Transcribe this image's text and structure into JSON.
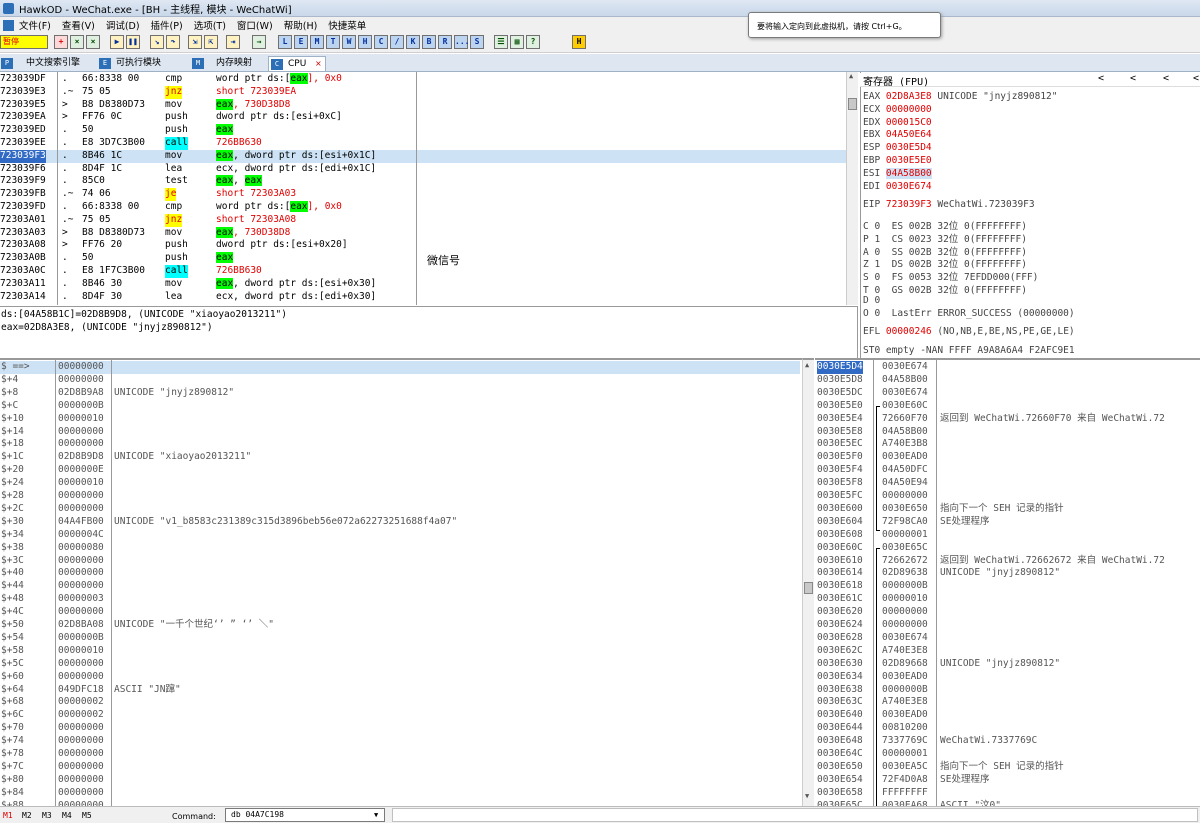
{
  "window": {
    "title": "HawkOD - WeChat.exe - [BH - 主线程, 模块 - WeChatWi]"
  },
  "tooltip": {
    "text": "要将输入定向到此虚拟机，请按 Ctrl+G。"
  },
  "menu": [
    "文件(F)",
    "查看(V)",
    "调试(D)",
    "插件(P)",
    "选项(T)",
    "窗口(W)",
    "帮助(H)",
    "快捷菜单"
  ],
  "toolbar": {
    "status_label": "暂停",
    "letter_buttons": [
      "L",
      "E",
      "M",
      "T",
      "W",
      "H",
      "C",
      "/",
      "K",
      "B",
      "R",
      "...",
      "S"
    ],
    "h_button": "H"
  },
  "tabs": [
    {
      "icon": "P",
      "label": ""
    },
    {
      "icon": "",
      "label": "中文搜索引擎"
    },
    {
      "icon": "E",
      "label": "可执行模块"
    },
    {
      "icon": "M",
      "label": "内存映射"
    },
    {
      "icon": "C",
      "label": "CPU"
    }
  ],
  "disasm": [
    {
      "addr": "723039DF",
      "mark": ".",
      "hex": "66:8338 00",
      "op": "cmp",
      "args": [
        "word ptr ds:[",
        "eax",
        "], 0x0"
      ]
    },
    {
      "addr": "723039E3",
      "mark": ".~",
      "hex": "75 05",
      "op": "jnz",
      "args": [
        "short 723039EA"
      ]
    },
    {
      "addr": "723039E5",
      "mark": ">",
      "hex": "B8 D8380D73",
      "op": "mov",
      "args": [
        "eax",
        ", 730D38D8"
      ]
    },
    {
      "addr": "723039EA",
      "mark": ">",
      "hex": "FF76 0C",
      "op": "push",
      "args": [
        "dword ptr ds:[esi+0xC]"
      ]
    },
    {
      "addr": "723039ED",
      "mark": ".",
      "hex": "50",
      "op": "push",
      "args": [
        "eax"
      ]
    },
    {
      "addr": "723039EE",
      "mark": ".",
      "hex": "E8 3D7C3B00",
      "op": "call",
      "args": [
        "726BB630"
      ]
    },
    {
      "addr": "723039F3",
      "mark": ".",
      "hex": "8B46 1C",
      "op": "mov",
      "args": [
        "eax",
        ", dword ptr ds:[esi+0x1C]"
      ]
    },
    {
      "addr": "723039F6",
      "mark": ".",
      "hex": "8D4F 1C",
      "op": "lea",
      "args": [
        "ecx, dword ptr ds:[edi+0x1C]"
      ]
    },
    {
      "addr": "723039F9",
      "mark": ".",
      "hex": "85C0",
      "op": "test",
      "args": [
        "eax",
        ", ",
        "eax"
      ]
    },
    {
      "addr": "723039FB",
      "mark": ".~",
      "hex": "74 06",
      "op": "je",
      "args": [
        "short 72303A03"
      ]
    },
    {
      "addr": "723039FD",
      "mark": ".",
      "hex": "66:8338 00",
      "op": "cmp",
      "args": [
        "word ptr ds:[",
        "eax",
        "], 0x0"
      ]
    },
    {
      "addr": "72303A01",
      "mark": ".~",
      "hex": "75 05",
      "op": "jnz",
      "args": [
        "short 72303A08"
      ]
    },
    {
      "addr": "72303A03",
      "mark": ">",
      "hex": "B8 D8380D73",
      "op": "mov",
      "args": [
        "eax",
        ", 730D38D8"
      ]
    },
    {
      "addr": "72303A08",
      "mark": ">",
      "hex": "FF76 20",
      "op": "push",
      "args": [
        "dword ptr ds:[esi+0x20]"
      ]
    },
    {
      "addr": "72303A0B",
      "mark": ".",
      "hex": "50",
      "op": "push",
      "args": [
        "eax"
      ]
    },
    {
      "addr": "72303A0C",
      "mark": ".",
      "hex": "E8 1F7C3B00",
      "op": "call",
      "args": [
        "726BB630"
      ]
    },
    {
      "addr": "72303A11",
      "mark": ".",
      "hex": "8B46 30",
      "op": "mov",
      "args": [
        "eax",
        ", dword ptr ds:[esi+0x30]"
      ]
    },
    {
      "addr": "72303A14",
      "mark": ".",
      "hex": "8D4F 30",
      "op": "lea",
      "args": [
        "ecx, dword ptr ds:[edi+0x30]"
      ]
    }
  ],
  "disasm_comment": "微信号",
  "info": [
    "ds:[04A58B1C]=02D8B9D8, (UNICODE \"xiaoyao2013211\")",
    "eax=02D8A3E8, (UNICODE \"jnyjz890812\")"
  ],
  "registers": {
    "header": "寄存器 (FPU)",
    "nav": [
      "<",
      "<",
      "<",
      "<"
    ],
    "lines": [
      {
        "name": "EAX",
        "val": "02D8A3E8",
        "note": "UNICODE \"jnyjz890812\""
      },
      {
        "name": "ECX",
        "val": "00000000",
        "note": ""
      },
      {
        "name": "EDX",
        "val": "000015C0",
        "note": ""
      },
      {
        "name": "EBX",
        "val": "04A50E64",
        "note": ""
      },
      {
        "name": "ESP",
        "val": "0030E5D4",
        "note": ""
      },
      {
        "name": "EBP",
        "val": "0030E5E0",
        "note": ""
      },
      {
        "name": "ESI",
        "val": "04A58B00",
        "note": ""
      },
      {
        "name": "EDI",
        "val": "0030E674",
        "note": ""
      }
    ],
    "eip": {
      "name": "EIP",
      "val": "723039F3",
      "note": "WeChatWi.723039F3"
    },
    "flags": [
      "C 0  ES 002B 32位 0(FFFFFFFF)",
      "P 1  CS 0023 32位 0(FFFFFFFF)",
      "A 0  SS 002B 32位 0(FFFFFFFF)",
      "Z 1  DS 002B 32位 0(FFFFFFFF)",
      "S 0  FS 0053 32位 7EFDD000(FFF)",
      "T 0  GS 002B 32位 0(FFFFFFFF)",
      "D 0",
      "O 0  LastErr ERROR_SUCCESS (00000000)"
    ],
    "efl": {
      "name": "EFL",
      "val": "00000246",
      "note": "(NO,NB,E,BE,NS,PE,GE,LE)"
    },
    "st0": "ST0 empty -NAN FFFF A9A8A6A4 F2AFC9E1"
  },
  "stack": [
    {
      "off": "$ ==>",
      "val": "00000000",
      "note": ""
    },
    {
      "off": "$+4",
      "val": "00000000",
      "note": ""
    },
    {
      "off": "$+8",
      "val": "02D8B9A8",
      "note": "UNICODE \"jnyjz890812\""
    },
    {
      "off": "$+C",
      "val": "0000000B",
      "note": ""
    },
    {
      "off": "$+10",
      "val": "00000010",
      "note": ""
    },
    {
      "off": "$+14",
      "val": "00000000",
      "note": ""
    },
    {
      "off": "$+18",
      "val": "00000000",
      "note": ""
    },
    {
      "off": "$+1C",
      "val": "02D8B9D8",
      "note": "UNICODE \"xiaoyao2013211\""
    },
    {
      "off": "$+20",
      "val": "0000000E",
      "note": ""
    },
    {
      "off": "$+24",
      "val": "00000010",
      "note": ""
    },
    {
      "off": "$+28",
      "val": "00000000",
      "note": ""
    },
    {
      "off": "$+2C",
      "val": "00000000",
      "note": ""
    },
    {
      "off": "$+30",
      "val": "04A4FB00",
      "note": "UNICODE \"v1_b8583c231389c315d3896beb56e072a62273251688f4a07\""
    },
    {
      "off": "$+34",
      "val": "0000004C",
      "note": ""
    },
    {
      "off": "$+38",
      "val": "00000080",
      "note": ""
    },
    {
      "off": "$+3C",
      "val": "00000000",
      "note": ""
    },
    {
      "off": "$+40",
      "val": "00000000",
      "note": ""
    },
    {
      "off": "$+44",
      "val": "00000000",
      "note": ""
    },
    {
      "off": "$+48",
      "val": "00000003",
      "note": ""
    },
    {
      "off": "$+4C",
      "val": "00000000",
      "note": ""
    },
    {
      "off": "$+50",
      "val": "02D8BA08",
      "note": "UNICODE \"一千个世纪‘’ ” ‘’ ＼\""
    },
    {
      "off": "$+54",
      "val": "0000000B",
      "note": ""
    },
    {
      "off": "$+58",
      "val": "00000010",
      "note": ""
    },
    {
      "off": "$+5C",
      "val": "00000000",
      "note": ""
    },
    {
      "off": "$+60",
      "val": "00000000",
      "note": ""
    },
    {
      "off": "$+64",
      "val": "049DFC18",
      "note": "ASCII \"JN蹿\""
    },
    {
      "off": "$+68",
      "val": "00000002",
      "note": ""
    },
    {
      "off": "$+6C",
      "val": "00000002",
      "note": ""
    },
    {
      "off": "$+70",
      "val": "00000000",
      "note": ""
    },
    {
      "off": "$+74",
      "val": "00000000",
      "note": ""
    },
    {
      "off": "$+78",
      "val": "00000000",
      "note": ""
    },
    {
      "off": "$+7C",
      "val": "00000000",
      "note": ""
    },
    {
      "off": "$+80",
      "val": "00000000",
      "note": ""
    },
    {
      "off": "$+84",
      "val": "00000000",
      "note": ""
    },
    {
      "off": "$+88",
      "val": "00000000",
      "note": ""
    }
  ],
  "mem": [
    {
      "addr": "0030E5D4",
      "val": "0030E674",
      "note": ""
    },
    {
      "addr": "0030E5D8",
      "val": "04A58B00",
      "note": ""
    },
    {
      "addr": "0030E5DC",
      "val": "0030E674",
      "note": ""
    },
    {
      "addr": "0030E5E0",
      "val": "0030E60C",
      "note": ""
    },
    {
      "addr": "0030E5E4",
      "val": "72660F70",
      "note": "返回到 WeChatWi.72660F70 来自 WeChatWi.72"
    },
    {
      "addr": "0030E5E8",
      "val": "04A58B00",
      "note": ""
    },
    {
      "addr": "0030E5EC",
      "val": "A740E3B8",
      "note": ""
    },
    {
      "addr": "0030E5F0",
      "val": "0030EAD0",
      "note": ""
    },
    {
      "addr": "0030E5F4",
      "val": "04A50DFC",
      "note": ""
    },
    {
      "addr": "0030E5F8",
      "val": "04A50E94",
      "note": ""
    },
    {
      "addr": "0030E5FC",
      "val": "00000000",
      "note": ""
    },
    {
      "addr": "0030E600",
      "val": "0030E650",
      "note": "指向下一个 SEH 记录的指针"
    },
    {
      "addr": "0030E604",
      "val": "72F98CA0",
      "note": "SE处理程序"
    },
    {
      "addr": "0030E608",
      "val": "00000001",
      "note": ""
    },
    {
      "addr": "0030E60C",
      "val": "0030E65C",
      "note": ""
    },
    {
      "addr": "0030E610",
      "val": "72662672",
      "note": "返回到 WeChatWi.72662672 来自 WeChatWi.72"
    },
    {
      "addr": "0030E614",
      "val": "02D89638",
      "note": "UNICODE \"jnyjz890812\""
    },
    {
      "addr": "0030E618",
      "val": "0000000B",
      "note": ""
    },
    {
      "addr": "0030E61C",
      "val": "00000010",
      "note": ""
    },
    {
      "addr": "0030E620",
      "val": "00000000",
      "note": ""
    },
    {
      "addr": "0030E624",
      "val": "00000000",
      "note": ""
    },
    {
      "addr": "0030E628",
      "val": "0030E674",
      "note": ""
    },
    {
      "addr": "0030E62C",
      "val": "A740E3E8",
      "note": ""
    },
    {
      "addr": "0030E630",
      "val": "02D89668",
      "note": "UNICODE \"jnyjz890812\""
    },
    {
      "addr": "0030E634",
      "val": "0030EAD0",
      "note": ""
    },
    {
      "addr": "0030E638",
      "val": "0000000B",
      "note": ""
    },
    {
      "addr": "0030E63C",
      "val": "A740E3E8",
      "note": ""
    },
    {
      "addr": "0030E640",
      "val": "0030EAD0",
      "note": ""
    },
    {
      "addr": "0030E644",
      "val": "00810200",
      "note": ""
    },
    {
      "addr": "0030E648",
      "val": "7337769C",
      "note": "WeChatWi.7337769C"
    },
    {
      "addr": "0030E64C",
      "val": "00000001",
      "note": ""
    },
    {
      "addr": "0030E650",
      "val": "0030EA5C",
      "note": "指向下一个 SEH 记录的指针"
    },
    {
      "addr": "0030E654",
      "val": "72F4D0A8",
      "note": "SE处理程序"
    },
    {
      "addr": "0030E658",
      "val": "FFFFFFFF",
      "note": ""
    },
    {
      "addr": "0030E65C",
      "val": "0030EA68",
      "note": "ASCII \"汶0\""
    }
  ],
  "statusbar": {
    "marks": [
      "M1",
      "M2",
      "M3",
      "M4",
      "M5"
    ],
    "command_label": "Command:",
    "command_value": "db 04A7C198"
  }
}
